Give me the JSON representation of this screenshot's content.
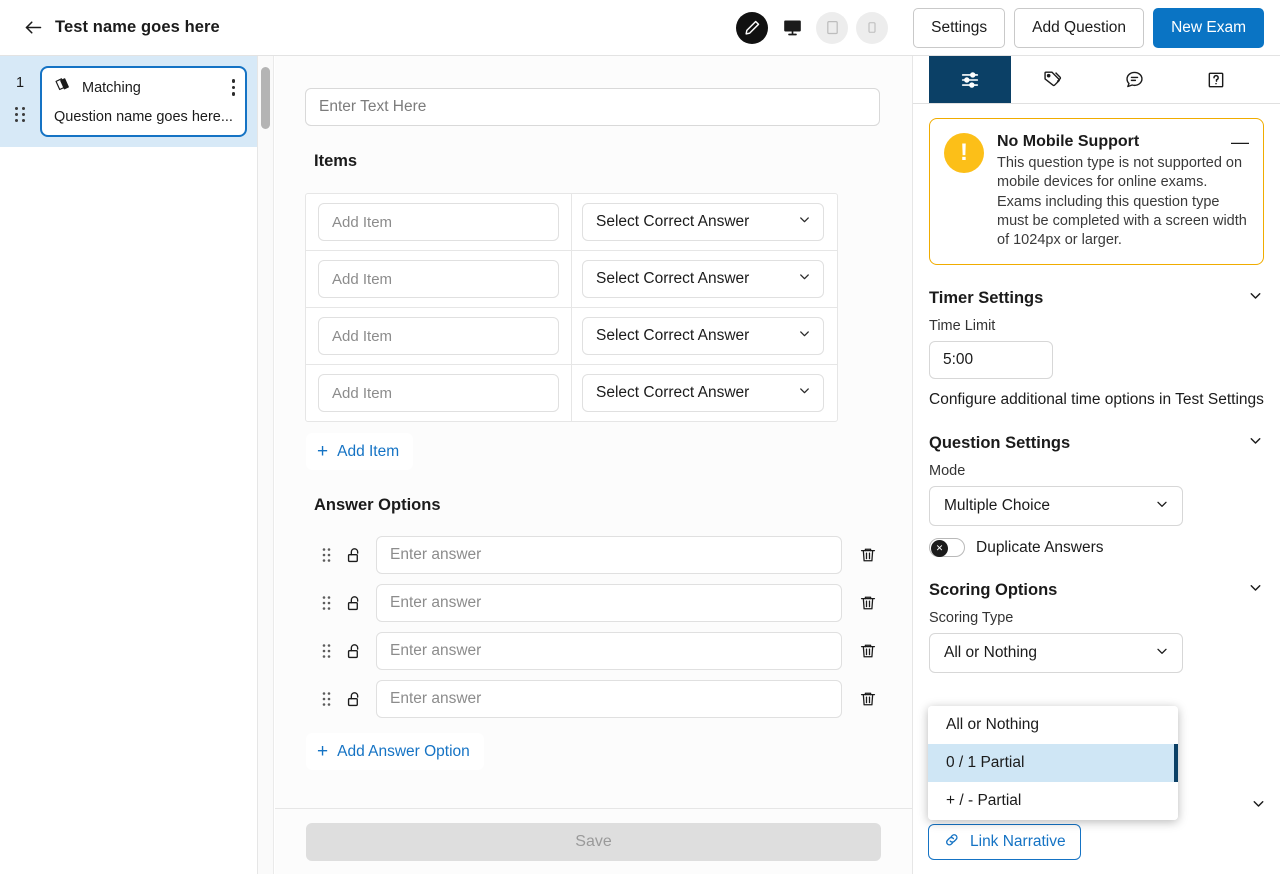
{
  "topbar": {
    "back_icon": "arrow-left-icon",
    "title": "Test name goes here",
    "device_icons": [
      {
        "name": "pencil-icon",
        "state": "active"
      },
      {
        "name": "desktop-icon",
        "state": "enabled"
      },
      {
        "name": "tablet-icon",
        "state": "muted"
      },
      {
        "name": "mobile-icon",
        "state": "muted"
      }
    ],
    "settings_label": "Settings",
    "add_question_label": "Add Question",
    "new_exam_label": "New Exam",
    "primary_color": "#0a74c4"
  },
  "sidebar": {
    "question": {
      "number": "1",
      "type_icon": "matching-cards-icon",
      "type": "Matching",
      "name": "Question name goes here...",
      "menu_icon": "kebab-menu-icon",
      "drag_icon": "drag-handle-icon",
      "selected_color": "#d7e9f7",
      "border_color": "#1573c4"
    }
  },
  "editor": {
    "question_text_placeholder": "Enter Text Here",
    "items_heading": "Items",
    "item_placeholder": "Add Item",
    "answer_select_placeholder": "Select Correct Answer",
    "items": [
      {
        "item": "",
        "answer": "Select Correct Answer"
      },
      {
        "item": "",
        "answer": "Select Correct Answer"
      },
      {
        "item": "",
        "answer": "Select Correct Answer"
      },
      {
        "item": "",
        "answer": "Select Correct Answer"
      }
    ],
    "add_item_label": "Add Item",
    "answer_options_heading": "Answer Options",
    "answer_placeholder": "Enter answer",
    "answer_options": [
      {
        "value": "",
        "locked": false
      },
      {
        "value": "",
        "locked": false
      },
      {
        "value": "",
        "locked": false
      },
      {
        "value": "",
        "locked": false
      }
    ],
    "add_answer_label": "Add Answer Option",
    "save_label": "Save",
    "link_color": "#1573c4"
  },
  "right_panel": {
    "tabs": [
      {
        "icon": "sliders-settings-icon",
        "active": true
      },
      {
        "icon": "tag-icon",
        "active": false
      },
      {
        "icon": "comment-icon",
        "active": false
      },
      {
        "icon": "help-question-icon",
        "active": false
      }
    ],
    "active_tab_color": "#0b4066",
    "alert": {
      "icon": "exclamation-icon",
      "icon_glyph": "!",
      "title": "No Mobile Support",
      "text": "This question type is not supported on mobile devices for online exams. Exams including this question type must be completed with a screen width of 1024px or larger.",
      "collapse_glyph": "—",
      "border_color": "#f0ac00",
      "icon_color": "#fcbf18"
    },
    "timer": {
      "heading": "Timer Settings",
      "time_limit_label": "Time Limit",
      "time_limit_value": "5:00",
      "hint": "Configure additional time options in Test Settings"
    },
    "question_settings": {
      "heading": "Question Settings",
      "mode_label": "Mode",
      "mode_value": "Multiple Choice",
      "duplicate_label": "Duplicate Answers",
      "duplicate_enabled": false,
      "toggle_glyph": "✕"
    },
    "scoring": {
      "heading": "Scoring Options",
      "type_label": "Scoring Type",
      "type_value": "All or Nothing",
      "options": [
        {
          "label": "All or Nothing",
          "selected": false
        },
        {
          "label": "0 / 1 Partial",
          "selected": true
        },
        {
          "label": "+ / - Partial",
          "selected": false
        }
      ],
      "highlight_color": "#cfe6f5",
      "marker_color": "#0b4066"
    },
    "narrative": {
      "icon": "link-chain-icon",
      "label": "Link Narrative"
    }
  }
}
